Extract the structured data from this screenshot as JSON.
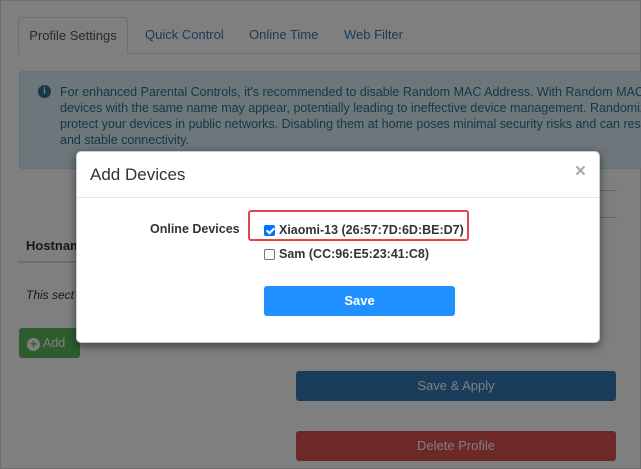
{
  "tabs": [
    {
      "label": "Profile Settings"
    },
    {
      "label": "Quick Control"
    },
    {
      "label": "Online Time"
    },
    {
      "label": "Web Filter"
    }
  ],
  "alert": {
    "icon": "info-circle-icon",
    "lines": [
      "For enhanced Parental Controls, it's recommended to disable Random MAC Address. With Random MAC A",
      "devices with the same name may appear, potentially leading to ineffective device management. Randomize",
      "protect your devices in public networks. Disabling them at home poses minimal security risks and can result",
      "and stable connectivity."
    ]
  },
  "table": {
    "hostname_header": "Hostnam",
    "section_note": "This sect"
  },
  "buttons": {
    "add_label": "Add",
    "save_apply_label": "Save & Apply",
    "delete_profile_label": "Delete Profile"
  },
  "modal": {
    "title": "Add Devices",
    "close_glyph": "×",
    "online_devices_label": "Online Devices",
    "devices": [
      {
        "label": "Xiaomi-13 (26:57:7D:6D:BE:D7)",
        "checked": true
      },
      {
        "label": "Sam (CC:96:E5:23:41:C8)",
        "checked": false
      }
    ],
    "save_label": "Save"
  },
  "colors": {
    "primary": "#337ab7",
    "success": "#5cb85c",
    "danger": "#d9534f",
    "modal_save": "#1e90ff",
    "highlight": "#e0474c"
  }
}
